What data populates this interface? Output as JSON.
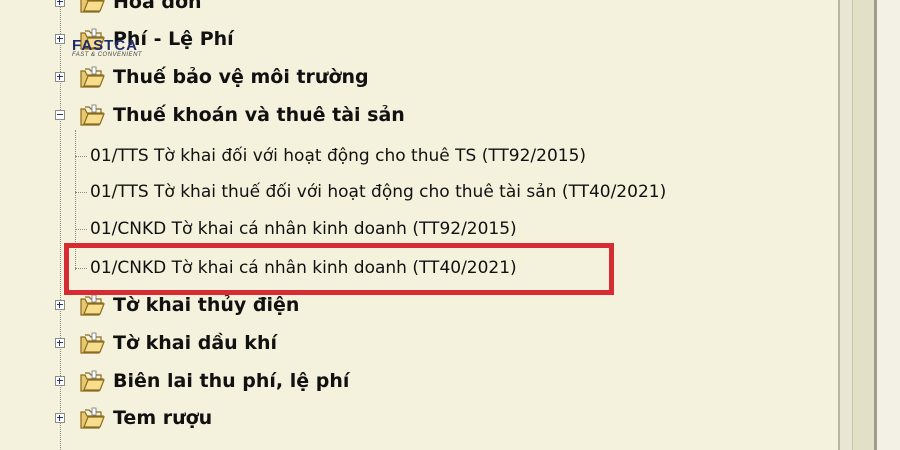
{
  "logo": {
    "name": "FASTCA",
    "tagline": "FAST & CONVENIENT"
  },
  "tree": {
    "folders_top": [
      {
        "label": "Hóa đơn",
        "state": "collapsed"
      },
      {
        "label": "Phí - Lệ Phí",
        "state": "collapsed"
      },
      {
        "label": "Thuế bảo vệ môi trường",
        "state": "collapsed"
      },
      {
        "label": "Thuế khoán và thuê tài sản",
        "state": "expanded"
      }
    ],
    "leaves": [
      {
        "label": "01/TTS Tờ khai đối với hoạt động cho thuê TS (TT92/2015)"
      },
      {
        "label": "01/TTS Tờ khai thuế đối với hoạt động cho thuê tài sản (TT40/2021)"
      },
      {
        "label": "01/CNKD Tờ khai cá nhân kinh doanh (TT92/2015)"
      },
      {
        "label": "01/CNKD Tờ khai cá nhân kinh doanh (TT40/2021)",
        "highlighted": true
      }
    ],
    "folders_bottom": [
      {
        "label": "Tờ khai thủy điện",
        "state": "collapsed"
      },
      {
        "label": "Tờ khai dầu khí",
        "state": "collapsed"
      },
      {
        "label": "Biên lai thu phí, lệ phí",
        "state": "collapsed"
      },
      {
        "label": "Tem rượu",
        "state": "collapsed"
      }
    ]
  },
  "colors": {
    "highlight_border": "#d72b34",
    "panel_bg": "#f4f2dc"
  },
  "icons": {
    "folder": "folder-open-icon",
    "expander": "tree-expander-icon"
  }
}
